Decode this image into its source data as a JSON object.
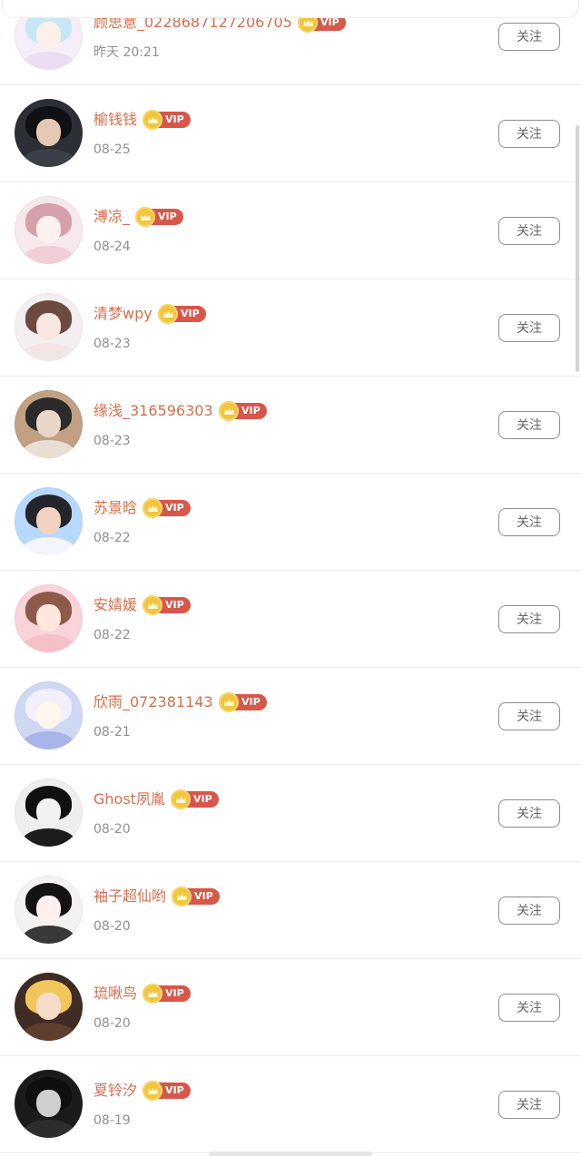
{
  "colors": {
    "name": "#d86e49",
    "time": "#8f8f8f",
    "vip_badge": "#d7574a",
    "crown": "#f2c53d",
    "follow_border": "#8d8d8d"
  },
  "vip_label": "VIP",
  "follow_label": "关注",
  "users": [
    {
      "name": "顾思意_0228687127206705",
      "time": "昨天 20:21",
      "avatar": {
        "bg": "#f5eef8",
        "hair": "#c7e7f7",
        "face": "#fff0ea",
        "body": "#eadcf3"
      }
    },
    {
      "name": "榆钱钱",
      "time": "08-25",
      "avatar": {
        "bg": "#2c2f35",
        "hair": "#101114",
        "face": "#e6c8b4",
        "body": "#3b3f48"
      }
    },
    {
      "name": "溥凉_",
      "time": "08-24",
      "avatar": {
        "bg": "#f7e8ec",
        "hair": "#d6a0aa",
        "face": "#fff1ee",
        "body": "#f0cfd8"
      }
    },
    {
      "name": "清梦wpy",
      "time": "08-23",
      "avatar": {
        "bg": "#f3eef0",
        "hair": "#6c4a3f",
        "face": "#fbe7e2",
        "body": "#f1e5e6"
      }
    },
    {
      "name": "缘浅_316596303",
      "time": "08-23",
      "avatar": {
        "bg": "#c1a083",
        "hair": "#2b2b2b",
        "face": "#ead6c6",
        "body": "#e9ded3"
      }
    },
    {
      "name": "苏景晗",
      "time": "08-22",
      "avatar": {
        "bg": "#b8d9ff",
        "hair": "#24252b",
        "face": "#f1d2c1",
        "body": "#f3f5fa"
      }
    },
    {
      "name": "安婧媛",
      "time": "08-22",
      "avatar": {
        "bg": "#f8d4d8",
        "hair": "#8b5a4a",
        "face": "#fde7df",
        "body": "#f6c0c8"
      }
    },
    {
      "name": "欣雨_072381143",
      "time": "08-21",
      "avatar": {
        "bg": "#cfd8f3",
        "hair": "#f2f0fb",
        "face": "#fff6ee",
        "body": "#a9b5e8"
      }
    },
    {
      "name": "Ghost夙胤",
      "time": "08-20",
      "avatar": {
        "bg": "#eeeeee",
        "hair": "#101010",
        "face": "#f4f1f3",
        "body": "#1c1c1c"
      }
    },
    {
      "name": "袖子超仙哟",
      "time": "08-20",
      "avatar": {
        "bg": "#f4f1f2",
        "hair": "#131313",
        "face": "#fff0ee",
        "body": "#393939"
      }
    },
    {
      "name": "琉啾鸟",
      "time": "08-20",
      "avatar": {
        "bg": "#3f2c24",
        "hair": "#f3c65d",
        "face": "#f5dcc8",
        "body": "#5e3f2f"
      }
    },
    {
      "name": "夏铃汐",
      "time": "08-19",
      "avatar": {
        "bg": "#1b1b1b",
        "hair": "#0f0f0f",
        "face": "#cfcfcf",
        "body": "#2d2d2d"
      }
    }
  ]
}
